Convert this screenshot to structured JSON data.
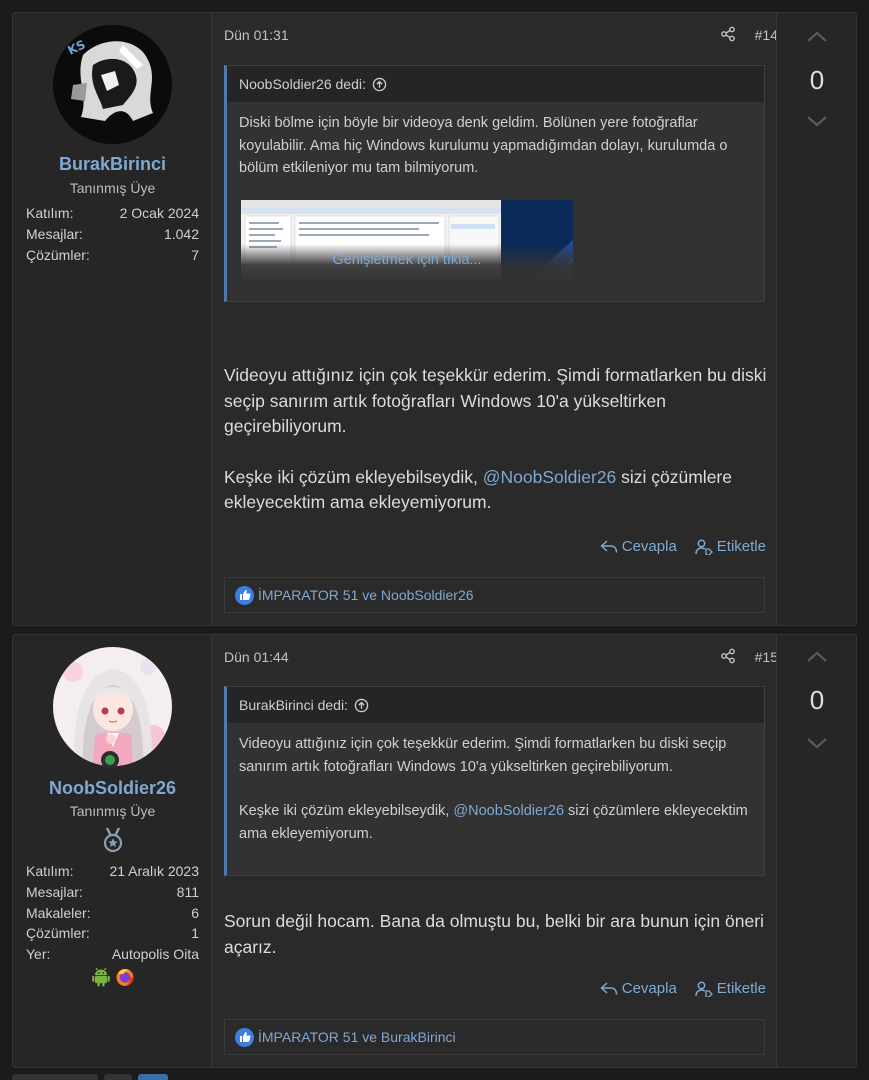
{
  "posts": [
    {
      "user": {
        "name": "BurakBirinci",
        "title": "Tanınmış Üye",
        "stats": [
          {
            "label": "Katılım:",
            "value": "2 Ocak 2024"
          },
          {
            "label": "Mesajlar:",
            "value": "1.042"
          },
          {
            "label": "Çözümler:",
            "value": "7"
          }
        ]
      },
      "date": "Dün 01:31",
      "number": "#14",
      "quote": {
        "author": "NoobSoldier26 dedi:",
        "text": "Diski bölme için böyle bir videoya denk geldim. Bölünen yere fotoğraflar koyulabilir. Ama hiç Windows kurulumu yapmadığımdan dolayı, kurulumda o bölüm etkileniyor mu tam bilmiyorum.",
        "expand": "Genişletmek için tıkla..."
      },
      "body": {
        "p1": "Videoyu attığınız için çok teşekkür ederim. Şimdi formatlarken bu diski seçip sanırım artık fotoğrafları Windows 10'a yükseltirken geçirebiliyorum.",
        "p2_before": "Keşke iki çözüm ekleyebilseydik, ",
        "p2_mention": "@NoobSoldier26",
        "p2_after": " sizi çözümlere ekleyecektim ama ekleyemiyorum."
      },
      "actions": {
        "reply": "Cevapla",
        "tag": "Etiketle"
      },
      "reactions": "İMPARATOR 51 ve NoobSoldier26",
      "vote_count": "0"
    },
    {
      "user": {
        "name": "NoobSoldier26",
        "title": "Tanınmış Üye",
        "stats": [
          {
            "label": "Katılım:",
            "value": "21 Aralık 2023"
          },
          {
            "label": "Mesajlar:",
            "value": "811"
          },
          {
            "label": "Makaleler:",
            "value": "6"
          },
          {
            "label": "Çözümler:",
            "value": "1"
          },
          {
            "label": "Yer:",
            "value": "Autopolis Oita"
          }
        ]
      },
      "date": "Dün 01:44",
      "number": "#15",
      "quote": {
        "author": "BurakBirinci dedi:",
        "p1": "Videoyu attığınız için çok teşekkür ederim. Şimdi formatlarken bu diski seçip sanırım artık fotoğrafları Windows 10'a yükseltirken geçirebiliyorum.",
        "p2_before": "Keşke iki çözüm ekleyebilseydik, ",
        "p2_mention": "@NoobSoldier26",
        "p2_after": " sizi çözümlere ekleyecektim ama ekleyemiyorum."
      },
      "body": {
        "p1": "Sorun değil hocam. Bana da olmuştu bu, belki bir ara bunun için öneri açarız."
      },
      "actions": {
        "reply": "Cevapla",
        "tag": "Etiketle"
      },
      "reactions": "İMPARATOR 51 ve BurakBirinci",
      "vote_count": "0"
    }
  ],
  "icons": {
    "share": "share-icon",
    "quote_up": "arrow-circle-up-icon",
    "reply": "reply-icon",
    "tag": "user-tag-icon",
    "like": "thumbs-up-icon",
    "vote_up": "chevron-up-icon",
    "vote_down": "chevron-down-icon",
    "badge": "medal-icon",
    "android": "android-icon",
    "firefox": "firefox-icon"
  },
  "colors": {
    "link": "#7fa9d2",
    "like": "#3d7ee0",
    "quote_bar": "#4d7bb0",
    "online": "#3ca04a"
  }
}
